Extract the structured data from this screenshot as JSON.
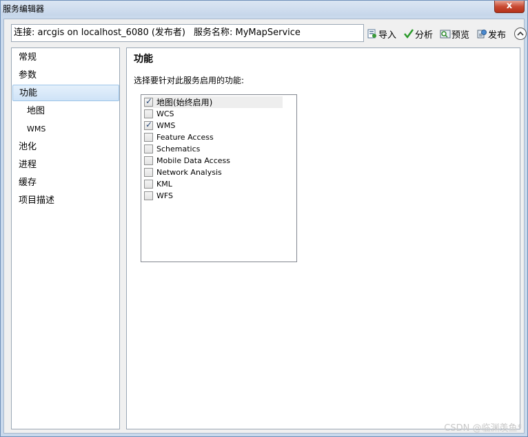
{
  "window": {
    "title": "服务编辑器",
    "close_label": "x"
  },
  "connection": {
    "label": "连接: arcgis on localhost_6080 (发布者)",
    "service_label": "服务名称: MyMapService"
  },
  "toolbar": {
    "import_label": "导入",
    "analyze_label": "分析",
    "preview_label": "预览",
    "publish_label": "发布",
    "collapse_icon": "chevron-up-icon"
  },
  "sidebar": {
    "items": [
      {
        "label": "常规"
      },
      {
        "label": "参数"
      },
      {
        "label": "功能",
        "selected": true
      },
      {
        "label": "地图"
      },
      {
        "label": "WMS"
      },
      {
        "label": "池化"
      },
      {
        "label": "进程"
      },
      {
        "label": "缓存"
      },
      {
        "label": "项目描述"
      }
    ]
  },
  "main": {
    "title": "功能",
    "description": "选择要针对此服务启用的功能:",
    "features": [
      {
        "label": "地图(始终启用)",
        "checked": true
      },
      {
        "label": "WCS",
        "checked": false
      },
      {
        "label": "WMS",
        "checked": true
      },
      {
        "label": "Feature Access",
        "checked": false
      },
      {
        "label": "Schematics",
        "checked": false
      },
      {
        "label": "Mobile Data Access",
        "checked": false
      },
      {
        "label": "Network Analysis",
        "checked": false
      },
      {
        "label": "KML",
        "checked": false
      },
      {
        "label": "WFS",
        "checked": false
      }
    ]
  },
  "watermark": "CSDN @临渊羡鱼*"
}
